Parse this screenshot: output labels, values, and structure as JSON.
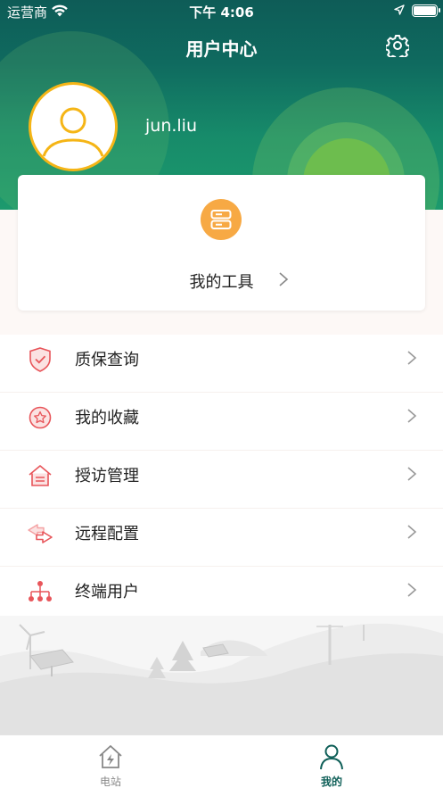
{
  "status_bar": {
    "carrier": "运营商",
    "time": "下午 4:06"
  },
  "navbar": {
    "title": "用户中心",
    "settings_icon": "gear-icon"
  },
  "profile": {
    "username": "jun.liu",
    "avatar_icon": "user-avatar-icon"
  },
  "tools": {
    "label": "我的工具",
    "icon": "server-icon",
    "icon_color": "#f7a944"
  },
  "menu": {
    "items": [
      {
        "label": "质保查询",
        "icon": "shield-check-icon"
      },
      {
        "label": "我的收藏",
        "icon": "star-badge-icon"
      },
      {
        "label": "授访管理",
        "icon": "house-list-icon"
      },
      {
        "label": "远程配置",
        "icon": "arrows-exchange-icon"
      },
      {
        "label": "终端用户",
        "icon": "network-users-icon"
      }
    ]
  },
  "tabbar": {
    "tabs": [
      {
        "label": "电站",
        "icon": "house-bolt-icon",
        "active": false
      },
      {
        "label": "我的",
        "icon": "person-icon",
        "active": true
      }
    ]
  },
  "colors": {
    "header": "#0f6a5f",
    "accent": "#0f5f58",
    "avatar_ring": "#f5b516",
    "icon_red": "#e8555a"
  }
}
